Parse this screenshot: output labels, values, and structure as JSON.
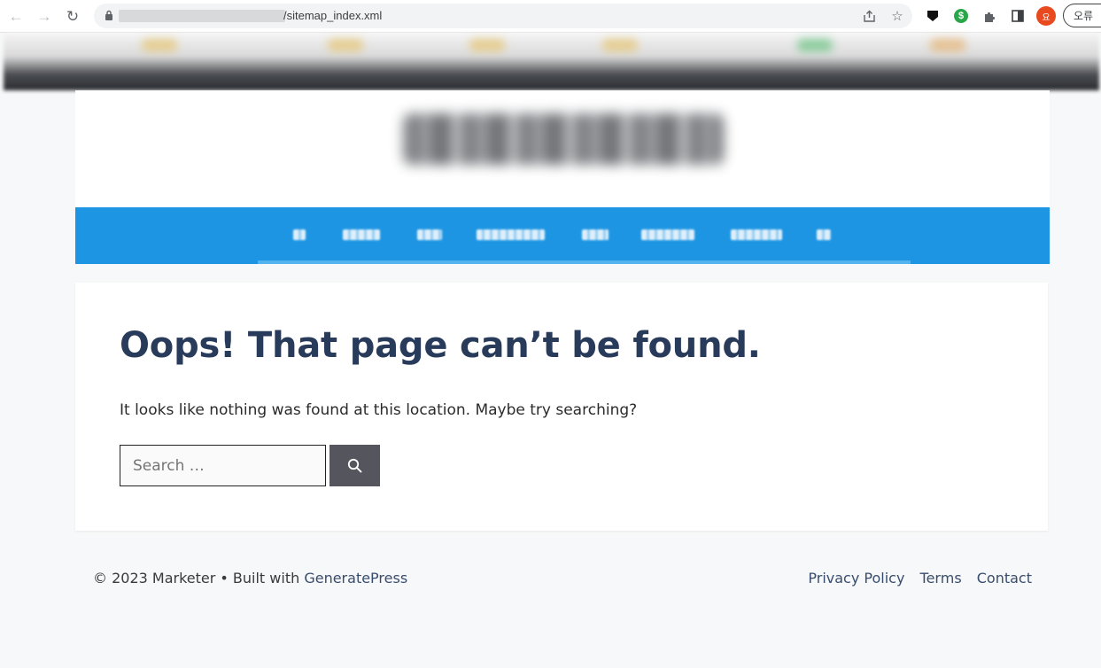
{
  "browser": {
    "url": "/sitemap_index.xml",
    "profile_initial": "요",
    "error_pill_label": "오류"
  },
  "page": {
    "title": "Oops! That page can’t be found.",
    "message": "It looks like nothing was found at this location. Maybe try searching?",
    "search": {
      "placeholder": "Search …"
    }
  },
  "footer": {
    "copyright": "© 2023 Marketer • Built with ",
    "builder_link": "GeneratePress",
    "links": [
      "Privacy Policy",
      "Terms",
      "Contact"
    ]
  },
  "colors": {
    "nav_bar": "#1e95e2",
    "title": "#283b5a",
    "search_button": "#55555e",
    "page_bg": "#f7f8f9"
  }
}
